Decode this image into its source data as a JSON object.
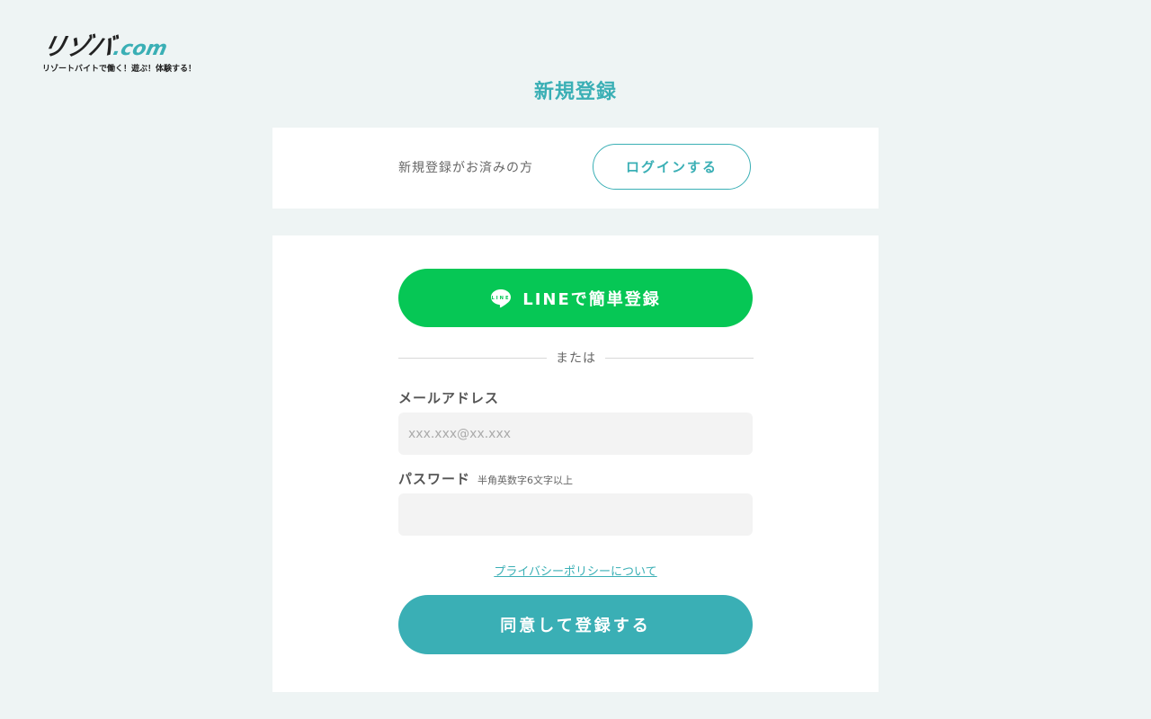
{
  "logo": {
    "main": "リゾバ",
    "com": ".com",
    "tagline": "リゾートバイトで働く！遊ぶ！体験する！"
  },
  "page": {
    "title": "新規登録"
  },
  "login_panel": {
    "prompt": "新規登録がお済みの方",
    "login_button_label": "ログインする"
  },
  "register_panel": {
    "line_button_label": "LINEで簡単登録",
    "line_icon_text": "LINE",
    "divider_text": "または",
    "email": {
      "label": "メールアドレス",
      "placeholder": "xxx.xxx@xx.xxx",
      "value": ""
    },
    "password": {
      "label": "パスワード",
      "hint": "半角英数字6文字以上",
      "placeholder": "",
      "value": ""
    },
    "privacy_link_label": "プライバシーポリシーについて",
    "submit_button_label": "同意して登録する"
  },
  "colors": {
    "accent": "#3aafb5",
    "line_green": "#06c755",
    "background": "#eef4f4",
    "panel": "#ffffff",
    "input_bg": "#f3f3f3"
  },
  "icons": {
    "line": "line-chat-bubble-icon"
  }
}
